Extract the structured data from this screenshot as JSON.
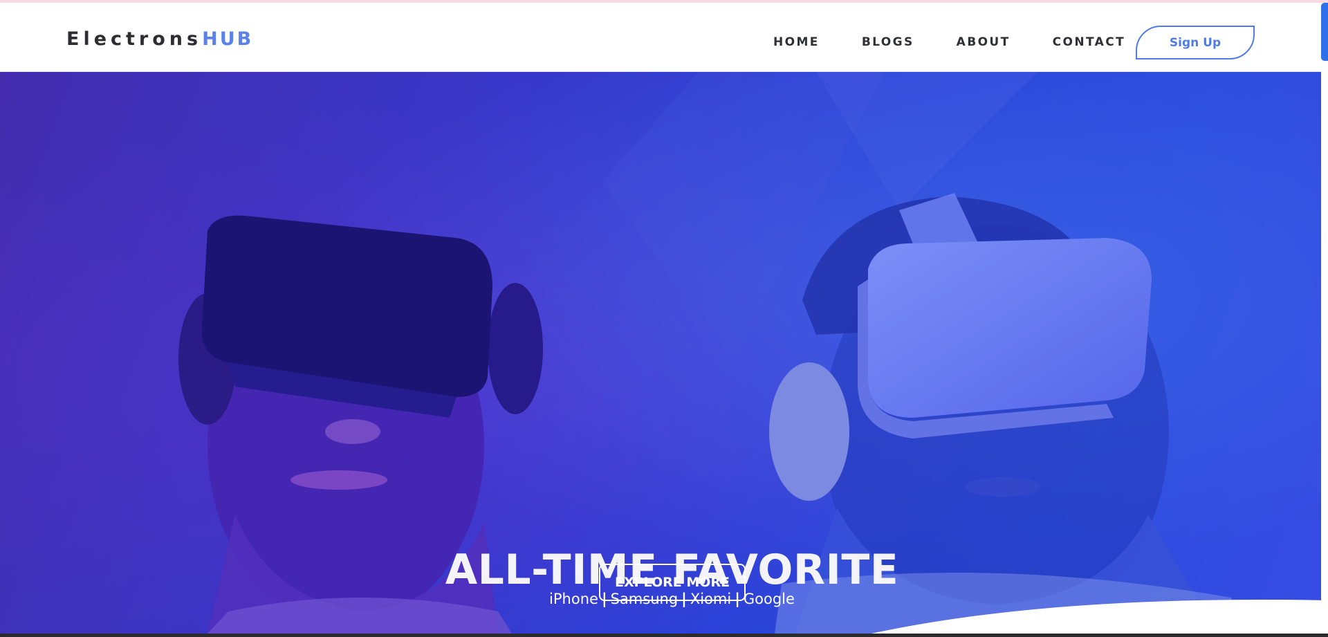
{
  "brand": {
    "name_part1": "Electrons",
    "name_part2": "HUB"
  },
  "nav": {
    "items": [
      {
        "label": "HOME"
      },
      {
        "label": "BLOGS"
      },
      {
        "label": "ABOUT"
      },
      {
        "label": "CONTACT"
      }
    ],
    "signup_label": "Sign Up"
  },
  "hero": {
    "title": "ALL-TIME FAVORITE",
    "brands": [
      "iPhone",
      "Samsung",
      "Xiomi",
      "Google"
    ],
    "separator": "|",
    "cta_label": "EXPLORE MORE"
  },
  "colors": {
    "accent": "#4f7be6",
    "logo_accent": "#5a83ea",
    "hero_overlay": "#2b45d9",
    "text_dark": "#2f2f36"
  },
  "icons": [
    "vr-headset-dark",
    "vr-headset-white"
  ]
}
